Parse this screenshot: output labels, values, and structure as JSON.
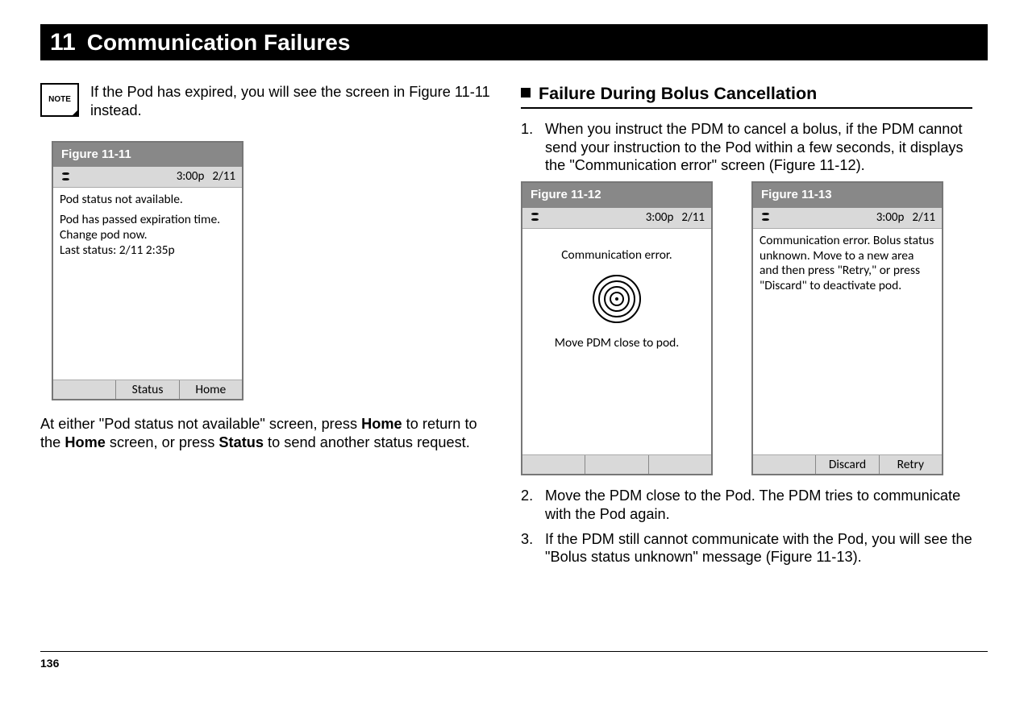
{
  "header": {
    "chapter_number": "11",
    "chapter_title": "Communication Failures"
  },
  "left": {
    "note_label": "NOTE",
    "note_text": "If the Pod has expired, you will see the screen in Figure 11-11 instead.",
    "figure11": {
      "caption": "Figure 11-11",
      "time": "3:00p",
      "date": "2/11",
      "line1": "Pod status not available.",
      "line2": "Pod has passed expiration time. Change pod now.",
      "line3": "Last status: 2/11 2:35p",
      "soft_center": "Status",
      "soft_right": "Home"
    },
    "after_fig_pre": "At either \"Pod status not available\" screen, press ",
    "after_fig_home": "Home",
    "after_fig_mid": " to return to the ",
    "after_fig_home2": "Home",
    "after_fig_mid2": " screen, or press ",
    "after_fig_status": "Status",
    "after_fig_end": " to send another status request."
  },
  "right": {
    "section_title": "Failure During Bolus Cancellation",
    "step1": "When you instruct the PDM to cancel a bolus, if the PDM cannot send your instruction to the Pod within a few seconds, it displays the \"Communication error\" screen (Figure 11-12).",
    "figure12": {
      "caption": "Figure 11-12",
      "time": "3:00p",
      "date": "2/11",
      "msg1": "Communication error.",
      "msg2": "Move PDM close to pod."
    },
    "figure13": {
      "caption": "Figure 11-13",
      "time": "3:00p",
      "date": "2/11",
      "body": "Communication error. Bolus status unknown. Move to a new area and then press \"Retry,\" or press \"Discard\" to deactivate pod.",
      "soft_center": "Discard",
      "soft_right": "Retry"
    },
    "step2": "Move the PDM close to the Pod. The PDM tries to communicate with the Pod again.",
    "step3": "If the PDM still cannot communicate with the Pod, you will see the \"Bolus status unknown\" message (Figure 11-13)."
  },
  "footer": {
    "page_number": "136"
  }
}
